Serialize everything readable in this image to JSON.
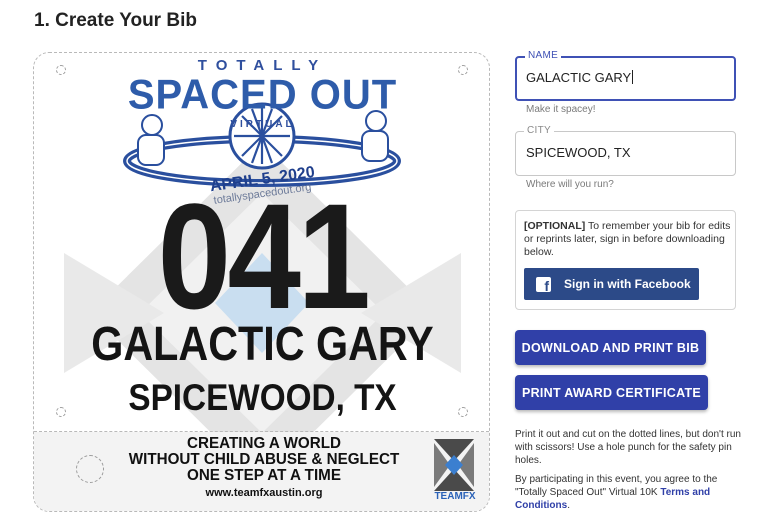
{
  "page": {
    "title": "1. Create Your Bib"
  },
  "bib": {
    "logo": {
      "totally": "TOTALLY",
      "spaced_out": "SPACED OUT",
      "virtual": "VIRTUAL",
      "date": "APRIL 5, 2020",
      "url": "totallyspacedout.org"
    },
    "number": "041",
    "name": "GALACTIC GARY",
    "city": "SPICEWOOD, TX",
    "slogan": [
      "CREATING A WORLD",
      "WITHOUT CHILD ABUSE & NEGLECT",
      "ONE STEP AT A TIME"
    ],
    "website": "www.teamfxaustin.org",
    "sponsor_logo_text": "TEAMFX"
  },
  "form": {
    "name_field": {
      "label": "NAME",
      "value": "GALACTIC GARY",
      "helper": "Make it spacey!"
    },
    "city_field": {
      "label": "CITY",
      "value": "SPICEWOOD, TX",
      "helper": "Where will you run?"
    },
    "signin": {
      "optional_label": "[OPTIONAL]",
      "text": " To remember your bib for edits or reprints later, sign in before downloading below.",
      "facebook_button": "Sign in with Facebook"
    },
    "download_button": "DOWNLOAD AND PRINT BIB",
    "award_button": "PRINT AWARD CERTIFICATE",
    "print_note": "Print it out and cut on the dotted lines, but don't run with scissors! Use a hole punch for the safety pin holes.",
    "agreement_prefix": "By participating in this event, you agree to the \"Totally Spaced Out\" Virtual 10K ",
    "terms_link": "Terms and Conditions",
    "agreement_suffix": "."
  },
  "colors": {
    "primary": "#3040a8",
    "facebook": "#2c4a88",
    "logo_blue": "#2e5caa"
  }
}
